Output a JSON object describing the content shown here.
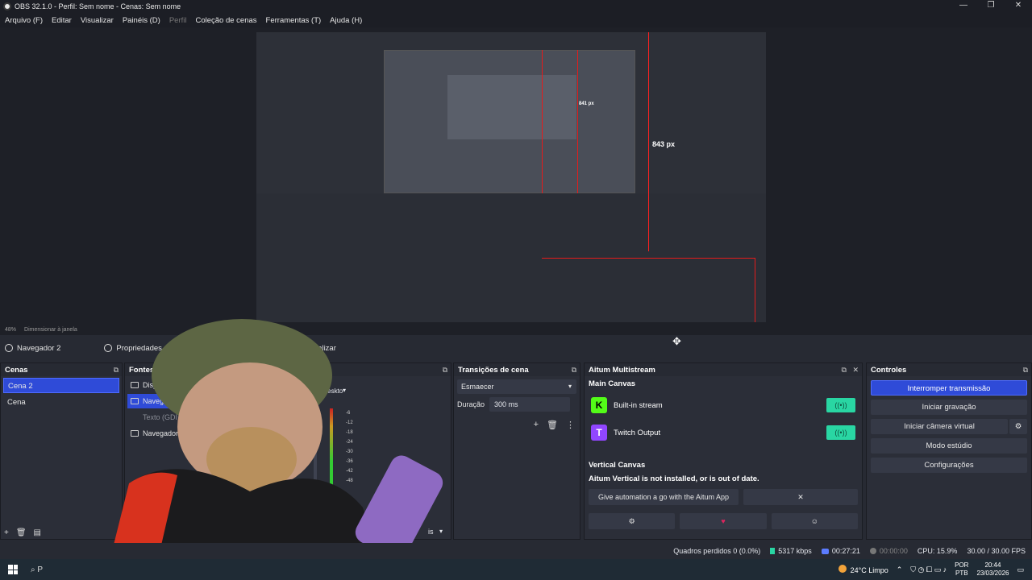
{
  "window": {
    "title": "OBS 32.1.0 - Perfil: Sem nome - Cenas: Sem nome",
    "controls": [
      "—",
      "❐",
      "✕"
    ]
  },
  "menu": [
    "Arquivo (F)",
    "Editar",
    "Visualizar",
    "Painéis (D)",
    "Perfil",
    "Coleção de cenas",
    "Ferramentas (T)",
    "Ajuda (H)"
  ],
  "preview": {
    "px_label": "843 px",
    "small_px_label": "841 px",
    "zoom": "48%",
    "scale_mode": "Dimensionar à janela"
  },
  "toolbar": {
    "source_name": "Navegador 2",
    "properties": "Propriedades",
    "refresh": "Atualizar"
  },
  "scenes": {
    "title": "Cenas",
    "items": [
      "Cena 2",
      "Cena"
    ],
    "selected": 0
  },
  "sources": {
    "title": "Fontes",
    "items": [
      {
        "label": "Disposit",
        "state": "normal"
      },
      {
        "label": "Navegador",
        "state": "selected"
      },
      {
        "label": "Texto (GDI+)",
        "state": "dim"
      },
      {
        "label": "Navegador",
        "state": "normal"
      }
    ]
  },
  "mixer": {
    "global_label": "lobal",
    "device_label": "o deskto",
    "db_ticks": [
      "-6",
      "-12",
      "-18",
      "-24",
      "-30",
      "-36",
      "-42",
      "-48"
    ],
    "status_fragment": "is"
  },
  "transitions": {
    "title": "Transições de cena",
    "selected": "Esmaecer",
    "duration_label": "Duração",
    "duration_value": "300 ms"
  },
  "multistream": {
    "title": "Aitum Multistream",
    "main_canvas": "Main Canvas",
    "outputs": [
      {
        "name": "Built-in stream",
        "logo": "K",
        "color": "#53fc18"
      },
      {
        "name": "Twitch Output",
        "logo": "T",
        "color": "#9146ff"
      }
    ],
    "vertical_canvas": "Vertical Canvas",
    "vertical_warning": "Aitum Vertical is not installed, or is out of date.",
    "automation_button": "Give automation a go with the Aitum App",
    "close_symbol": "✕"
  },
  "controls": {
    "title": "Controles",
    "buttons": [
      "Interromper transmissão",
      "Iniciar gravação",
      "Iniciar câmera virtual",
      "Modo estúdio",
      "Configurações"
    ]
  },
  "status": {
    "dropped_frames": "Quadros perdidos 0 (0.0%)",
    "bitrate": "5317 kbps",
    "live_time": "00:27:21",
    "rec_time": "00:00:00",
    "cpu": "CPU: 15.9%",
    "fps": "30.00 / 30.00 FPS"
  },
  "taskbar": {
    "search_fragment": "P",
    "weather": "24°C  Limpo",
    "lang_top": "POR",
    "lang_bottom": "PTB",
    "time": "20:44",
    "date": "23/03/2026"
  },
  "colors": {
    "accent": "#2f4bd8",
    "stream_toggle": "#29d6a3",
    "guide_red": "#e41c1c"
  }
}
